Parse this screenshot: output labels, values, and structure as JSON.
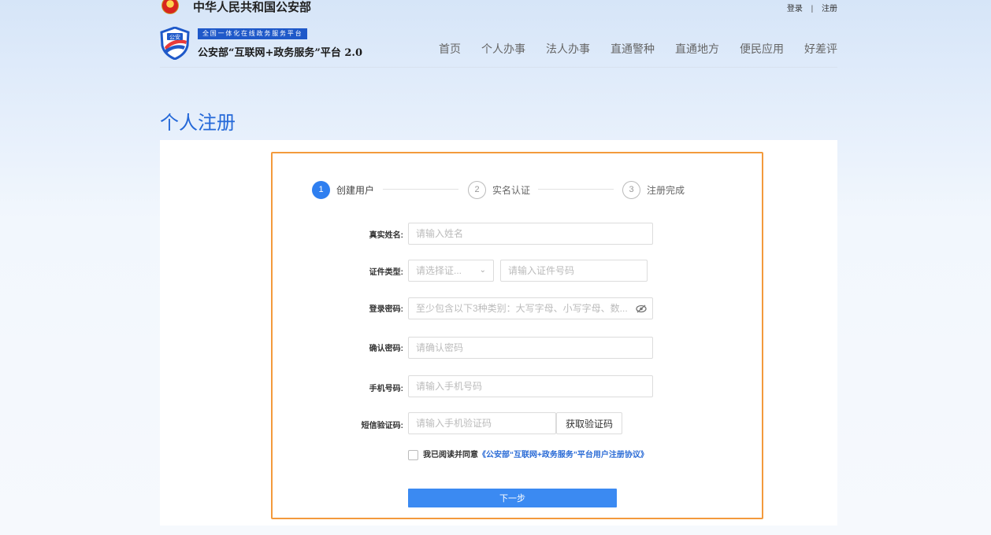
{
  "topbar": {
    "gov_title": "中华人民共和国公安部",
    "login": "登录",
    "separator": "|",
    "register": "注册"
  },
  "header": {
    "shield_text": "公安",
    "platform_banner": "全国一体化在线政务服务平台",
    "platform_name": "公安部“互联网+政务服务”平台 2.0",
    "nav": [
      "首页",
      "个人办事",
      "法人办事",
      "直通警种",
      "直通地方",
      "便民应用",
      "好差评"
    ]
  },
  "page": {
    "title": "个人注册"
  },
  "steps": [
    {
      "num": "1",
      "label": "创建用户",
      "active": true
    },
    {
      "num": "2",
      "label": "实名认证",
      "active": false
    },
    {
      "num": "3",
      "label": "注册完成",
      "active": false
    }
  ],
  "form": {
    "name_label": "真实姓名:",
    "name_placeholder": "请输入姓名",
    "idtype_label": "证件类型:",
    "idtype_placeholder": "请选择证...",
    "idnum_placeholder": "请输入证件号码",
    "password_label": "登录密码:",
    "password_placeholder": "至少包含以下3种类别：大写字母、小写字母、数...",
    "confirm_label": "确认密码:",
    "confirm_placeholder": "请确认密码",
    "phone_label": "手机号码:",
    "phone_placeholder": "请输入手机号码",
    "sms_label": "短信验证码:",
    "sms_placeholder": "请输入手机验证码",
    "sms_button": "获取验证码",
    "agree_prefix": "我已阅读并同意",
    "agree_link": "《公安部“互联网+政务服务”平台用户注册协议》",
    "next_button": "下一步"
  },
  "icons": {
    "eye": "eye-slash-icon",
    "chevron": "chevron-down-icon",
    "emblem": "national-emblem-icon",
    "shield": "police-shield-logo"
  },
  "colors": {
    "primary": "#2f7ff0",
    "title_blue": "#2468d8",
    "highlight": "#f39a3c",
    "banner": "#1f59c9"
  }
}
